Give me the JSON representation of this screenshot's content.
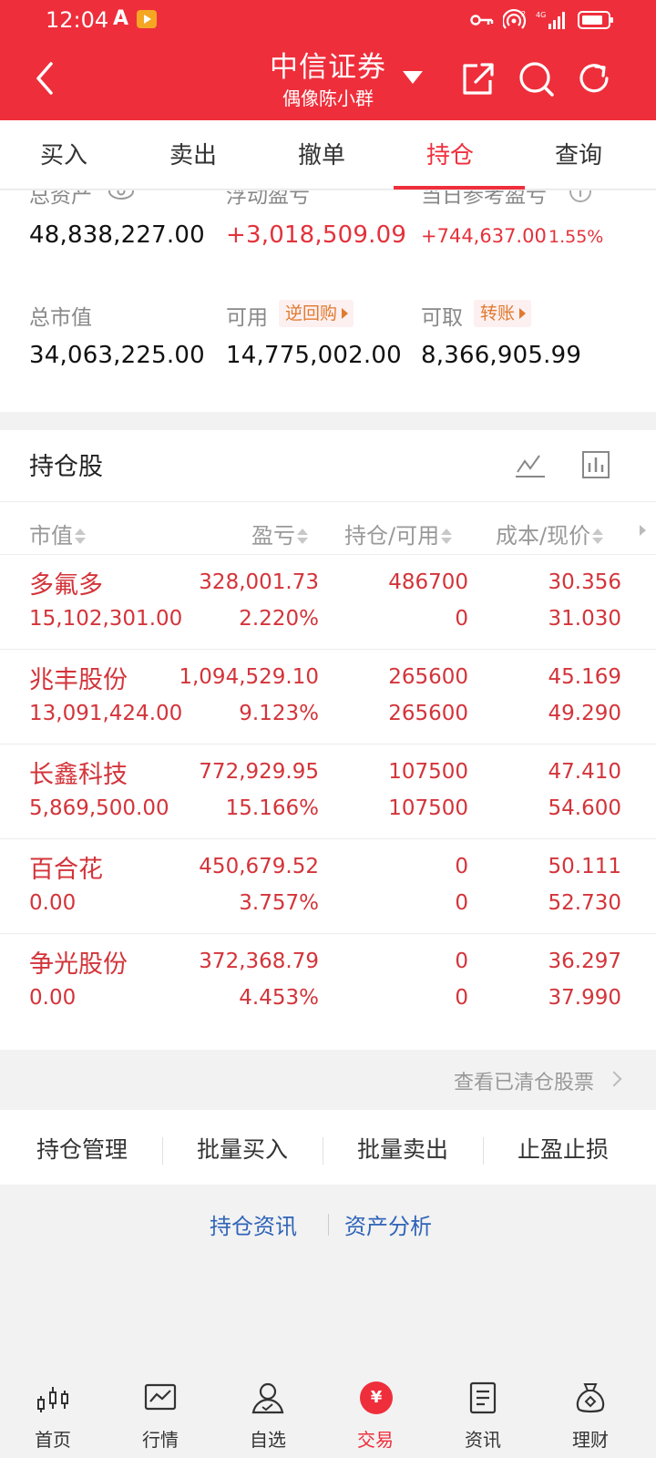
{
  "status_bar": {
    "time": "12:04",
    "network": "4G"
  },
  "header": {
    "title": "中信证券",
    "subtitle": "偶像陈小群"
  },
  "tabs": [
    {
      "label": "买入"
    },
    {
      "label": "卖出"
    },
    {
      "label": "撤单"
    },
    {
      "label": "持仓",
      "active": true
    },
    {
      "label": "查询"
    }
  ],
  "summary": {
    "total_assets_label": "总资产",
    "total_assets": "48,838,227.00",
    "floating_pnl_label": "浮动盈亏",
    "floating_pnl": "+3,018,509.09",
    "today_pnl_label": "当日参考盈亏",
    "today_pnl": "+744,637.00",
    "today_pnl_pct": "1.55%",
    "market_value_label": "总市值",
    "market_value": "34,063,225.00",
    "available_label": "可用",
    "available": "14,775,002.00",
    "reverse_repo_label": "逆回购",
    "withdrawable_label": "可取",
    "withdrawable": "8,366,905.99",
    "transfer_label": "转账"
  },
  "holdings": {
    "title": "持仓股",
    "columns": [
      "市值",
      "盈亏",
      "持仓/可用",
      "成本/现价"
    ],
    "rows": [
      {
        "name": "多氟多",
        "market_value": "15,102,301.00",
        "pnl": "328,001.73",
        "pnl_pct": "2.220%",
        "position": "486700",
        "available": "0",
        "cost": "30.356",
        "price": "31.030"
      },
      {
        "name": "兆丰股份",
        "market_value": "13,091,424.00",
        "pnl": "1,094,529.10",
        "pnl_pct": "9.123%",
        "position": "265600",
        "available": "265600",
        "cost": "45.169",
        "price": "49.290"
      },
      {
        "name": "长鑫科技",
        "market_value": "5,869,500.00",
        "pnl": "772,929.95",
        "pnl_pct": "15.166%",
        "position": "107500",
        "available": "107500",
        "cost": "47.410",
        "price": "54.600"
      },
      {
        "name": "百合花",
        "market_value": "0.00",
        "pnl": "450,679.52",
        "pnl_pct": "3.757%",
        "position": "0",
        "available": "0",
        "cost": "50.111",
        "price": "52.730"
      },
      {
        "name": "争光股份",
        "market_value": "0.00",
        "pnl": "372,368.79",
        "pnl_pct": "4.453%",
        "position": "0",
        "available": "0",
        "cost": "36.297",
        "price": "37.990"
      }
    ]
  },
  "view_cleared": "查看已清仓股票",
  "actions": [
    "持仓管理",
    "批量买入",
    "批量卖出",
    "止盈止损"
  ],
  "links": [
    "持仓资讯",
    "资产分析"
  ],
  "bottom_nav": [
    {
      "label": "首页",
      "icon": "candlestick-icon"
    },
    {
      "label": "行情",
      "icon": "chart-icon"
    },
    {
      "label": "自选",
      "icon": "user-check-icon"
    },
    {
      "label": "交易",
      "icon": "yen-icon",
      "active": true
    },
    {
      "label": "资讯",
      "icon": "document-icon"
    },
    {
      "label": "理财",
      "icon": "money-bag-icon"
    }
  ],
  "colors": {
    "brand_red": "#ef2e3b",
    "profit_red": "#d3343a",
    "link_blue": "#2f64b8",
    "badge_orange": "#e07a2f"
  }
}
